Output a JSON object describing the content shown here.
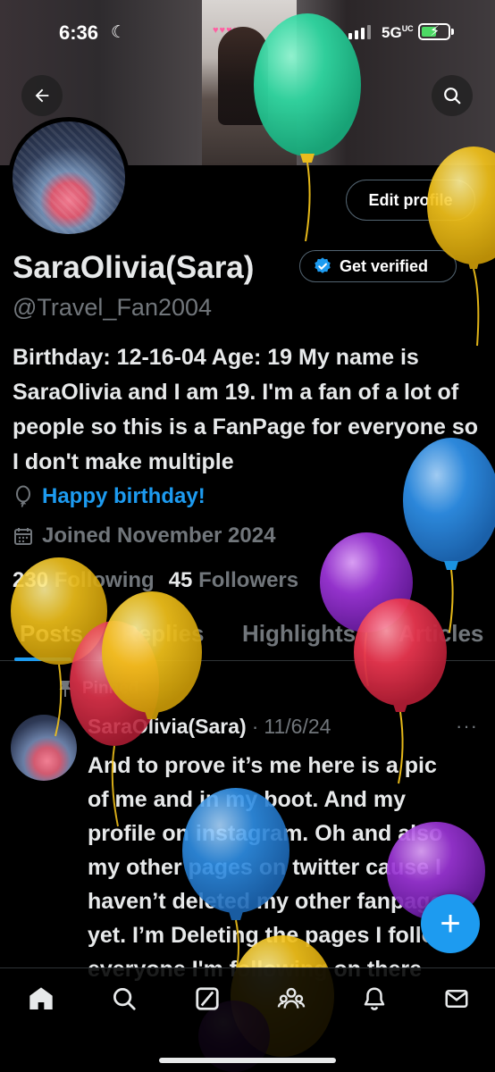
{
  "status_bar": {
    "time": "6:36",
    "network": "5G",
    "network_suffix": "UC"
  },
  "profile": {
    "display_name": "SaraOlivia(Sara)",
    "handle": "@Travel_Fan2004",
    "edit_label": "Edit profile",
    "verify_label": "Get verified",
    "bio": "Birthday: 12-16-04 Age: 19 My name is SaraOlivia and I am 19. I'm a fan of a lot of people so this is a FanPage for everyone so I don't make multiple",
    "birthday_text": "Happy birthday!",
    "joined_text": "Joined November 2024",
    "following_count": "230",
    "following_label": "Following",
    "followers_count": "45",
    "followers_label": "Followers"
  },
  "tabs": [
    {
      "label": "Posts",
      "active": true
    },
    {
      "label": "Replies",
      "active": false
    },
    {
      "label": "Highlights",
      "active": false
    },
    {
      "label": "Articles",
      "active": false
    }
  ],
  "post": {
    "pinned_label": "Pinned",
    "author": "SaraOlivia(Sara)",
    "separator": "·",
    "date": "11/6/24",
    "more_label": "···",
    "text": "And to prove it’s me here is a pic of me and in my boot. And my profile on instagram. Oh and also my other pages on twitter cause I haven’t deleted my other fanpage yet. I’m Deleting the pages I follow everyone I'm following on there"
  },
  "fab": {
    "label": "+"
  },
  "nav_items": [
    "home-icon",
    "search-icon",
    "grok-icon",
    "communities-icon",
    "notifications-icon",
    "messages-icon"
  ],
  "colors": {
    "accent": "#1d9bf0",
    "text_primary": "#e7e9ea",
    "text_secondary": "#71767b",
    "background": "#000000",
    "balloon_green": "#2fd6a0",
    "balloon_yellow": "#f2c21b",
    "balloon_blue": "#2f8fe6",
    "balloon_purple": "#9b35d6",
    "balloon_red": "#e8364f"
  }
}
